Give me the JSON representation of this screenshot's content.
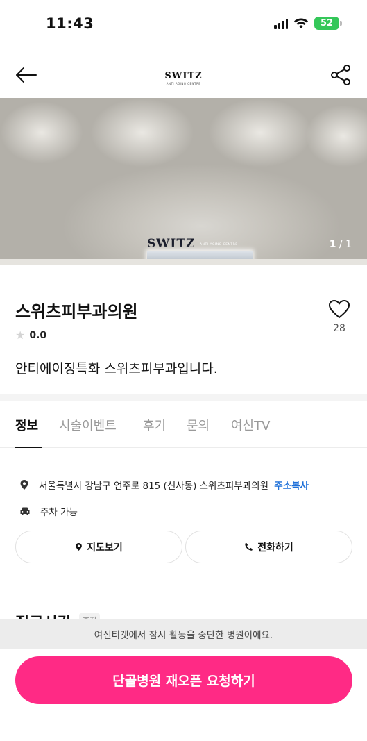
{
  "status_bar": {
    "time": "11:43",
    "battery": "52"
  },
  "header": {
    "logo": "SWITZ",
    "logo_sub": "ANTI AGING CENTRE"
  },
  "hero": {
    "sign_text": "SWITZ",
    "sign_sub": "ANTI AGING CENTRE",
    "counter_current": "1",
    "counter_total": "/ 1"
  },
  "clinic": {
    "name": "스위츠피부과의원",
    "rating": "0.0",
    "tagline": "안티에이징특화 스위츠피부과입니다.",
    "like_count": "28"
  },
  "tabs": [
    {
      "label": "정보",
      "active": true
    },
    {
      "label": "시술이벤트",
      "active": false
    },
    {
      "label": "후기",
      "active": false
    },
    {
      "label": "문의",
      "active": false
    },
    {
      "label": "여신TV",
      "active": false
    }
  ],
  "info": {
    "address": "서울특별시 강남구 언주로 815 (신사동) 스위츠피부과의원",
    "copy_address": "주소복사",
    "parking": "주차 가능",
    "map_button": "지도보기",
    "call_button": "전화하기"
  },
  "hours": {
    "title": "진료시간",
    "badge": "휴진"
  },
  "notice": "여신티켓에서 잠시 활동을 중단한 병원이에요.",
  "cta": "단골병원 재오픈 요청하기",
  "colors": {
    "cta": "#ff2a85",
    "link": "#1d6fd8",
    "battery": "#34c759"
  }
}
